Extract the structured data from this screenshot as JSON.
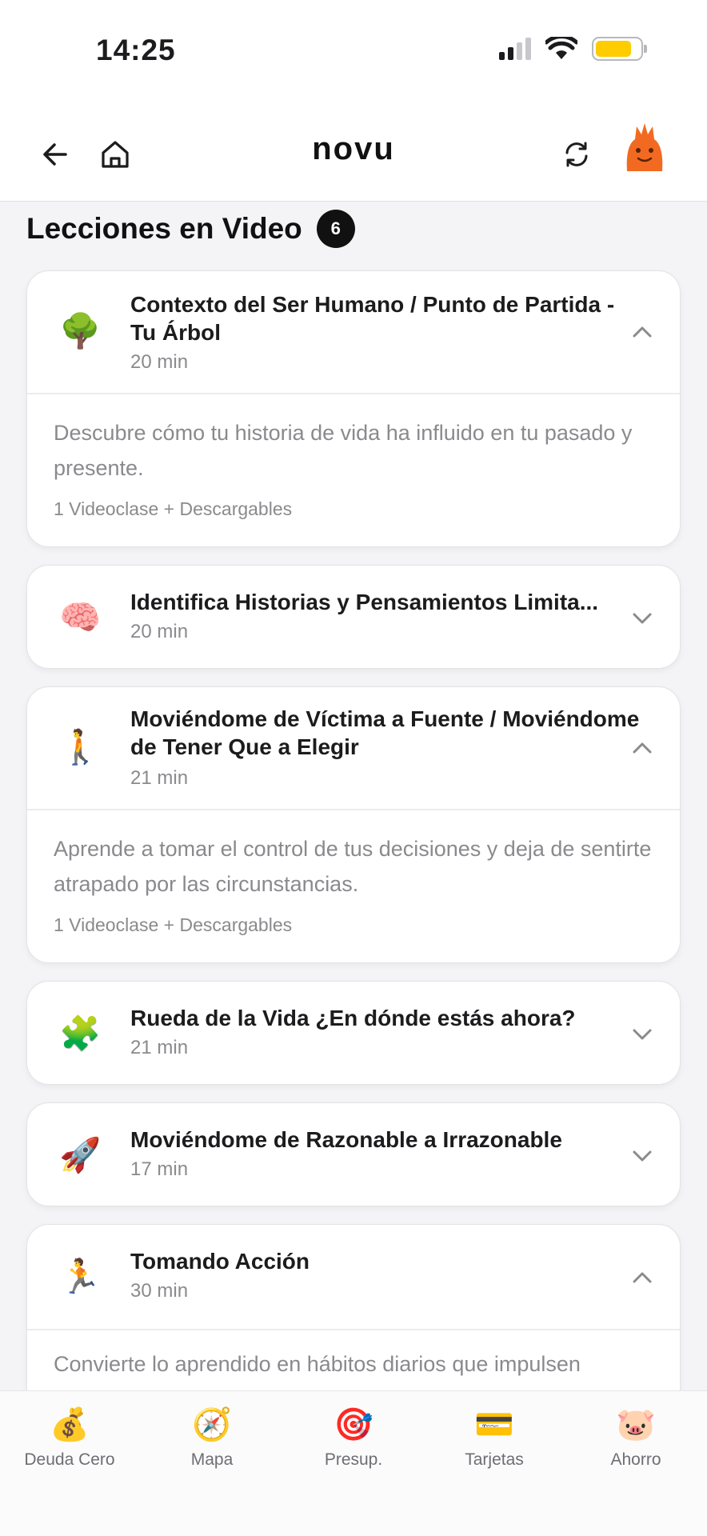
{
  "status_bar": {
    "time": "14:25"
  },
  "nav": {
    "logo": "novu"
  },
  "section": {
    "title": "Lecciones en Video",
    "count": "6"
  },
  "lessons": [
    {
      "emoji": "🌳",
      "title": "Contexto del Ser Humano / Punto de Partida - Tu Árbol",
      "duration": "20 min",
      "expanded": true,
      "description": "Descubre cómo tu historia de vida ha influido en tu pasado y presente.",
      "meta": "1 Videoclase + Descargables"
    },
    {
      "emoji": "🧠",
      "title": "Identifica Historias y Pensamientos Limita...",
      "duration": "20 min",
      "expanded": false
    },
    {
      "emoji": "🚶",
      "title": "Moviéndome de Víctima a Fuente / Moviéndome de Tener Que a Elegir",
      "duration": "21 min",
      "expanded": true,
      "description": "Aprende a tomar el control de tus decisiones y deja de sentirte atrapado por las circunstancias.",
      "meta": "1 Videoclase + Descargables"
    },
    {
      "emoji": "🧩",
      "title": "Rueda de la Vida ¿En dónde estás ahora?",
      "duration": "21 min",
      "expanded": false
    },
    {
      "emoji": "🚀",
      "title": "Moviéndome de Razonable a Irrazonable",
      "duration": "17 min",
      "expanded": false
    },
    {
      "emoji": "🏃",
      "title": "Tomando Acción",
      "duration": "30 min",
      "expanded": true,
      "description": "Convierte lo aprendido en hábitos diarios que impulsen"
    }
  ],
  "tabs": [
    {
      "icon": "💰",
      "label": "Deuda Cero"
    },
    {
      "icon": "🧭",
      "label": "Mapa"
    },
    {
      "icon": "🎯",
      "label": "Presup."
    },
    {
      "icon": "💳",
      "label": "Tarjetas"
    },
    {
      "icon": "🐷",
      "label": "Ahorro"
    }
  ]
}
